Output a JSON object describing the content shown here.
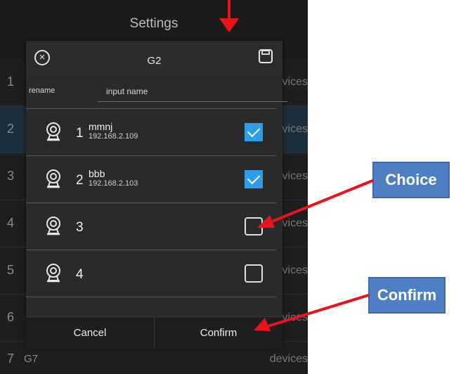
{
  "app": {
    "title": "Settings"
  },
  "background_rows": [
    {
      "num": "1",
      "device": "devices",
      "selected": false
    },
    {
      "num": "2",
      "device": "devices",
      "selected": true
    },
    {
      "num": "3",
      "device": "devices",
      "selected": false
    },
    {
      "num": "4",
      "device": "devices",
      "selected": false
    },
    {
      "num": "5",
      "device": "devices",
      "selected": false
    },
    {
      "num": "6",
      "device": "devices",
      "selected": false
    },
    {
      "num": "7",
      "group": "G7",
      "device": "devices",
      "selected": false
    }
  ],
  "dialog": {
    "title": "G2",
    "close_icon": "close-circle-icon",
    "save_icon": "save-icon",
    "rename_label": "rename",
    "name_input": {
      "value": "",
      "placeholder": "input name"
    },
    "cameras": [
      {
        "num": "1",
        "name": "mmnj",
        "ip": "192.168.2.109",
        "checked": true
      },
      {
        "num": "2",
        "name": "bbb",
        "ip": "192.168.2.103",
        "checked": true
      },
      {
        "num": "3",
        "name": "",
        "ip": "",
        "checked": false
      },
      {
        "num": "4",
        "name": "",
        "ip": "",
        "checked": false
      }
    ],
    "cancel_label": "Cancel",
    "confirm_label": "Confirm"
  },
  "annotations": {
    "choice_label": "Choice",
    "confirm_label": "Confirm",
    "arrow_color": "#e8141c"
  },
  "colors": {
    "checkbox_checked": "#2e9de8",
    "selected_row": "#1c2d3b",
    "callout": "#4e7fc2"
  }
}
